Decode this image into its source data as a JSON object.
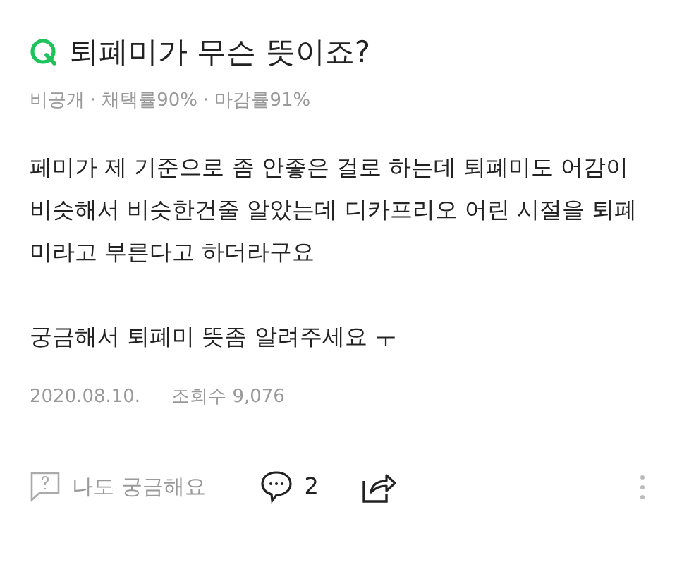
{
  "question": {
    "title": "퇴폐미가 무슨 뜻이죠?",
    "meta": [
      "비공개",
      "채택률90%",
      "마감률91%"
    ],
    "meta_separator": "·",
    "body": [
      "페미가 제 기준으로 좀 안좋은 걸로 하는데 퇴폐미도 어감이 비슷해서 비슷한건줄 알았는데 디카프리오 어린 시절을 퇴폐미라고 부른다고 하더라구요",
      "궁금해서 퇴폐미 뜻좀 알려주세요 ㅜ"
    ],
    "date": "2020.08.10.",
    "views": "조회수 9,076"
  },
  "actions": {
    "curious": "나도 궁금해요",
    "comments": "2"
  }
}
